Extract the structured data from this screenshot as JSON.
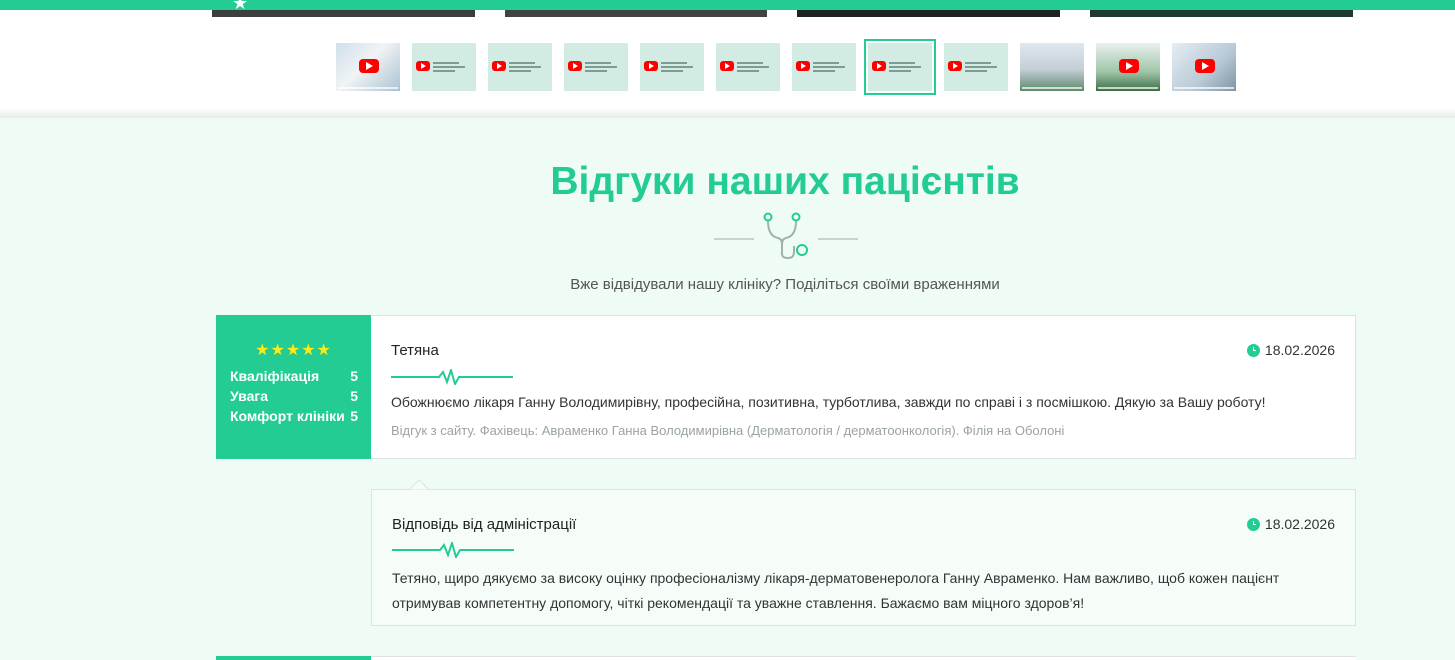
{
  "colors": {
    "accent": "#22cc93",
    "star": "#ffeb12",
    "background": "#effcf6"
  },
  "gallery": {
    "thumbnails": [
      {
        "style": "photo",
        "icon": "youtube-play-icon"
      },
      {
        "style": "text",
        "icon": "youtube-play-icon"
      },
      {
        "style": "text",
        "icon": "youtube-play-icon"
      },
      {
        "style": "text",
        "icon": "youtube-play-icon"
      },
      {
        "style": "text",
        "icon": "youtube-play-icon"
      },
      {
        "style": "text",
        "icon": "youtube-play-icon"
      },
      {
        "style": "text",
        "icon": "youtube-play-icon"
      },
      {
        "style": "text",
        "icon": "youtube-play-icon",
        "active": true
      },
      {
        "style": "text",
        "icon": "youtube-play-icon"
      },
      {
        "style": "building",
        "icon": ""
      },
      {
        "style": "green",
        "icon": "youtube-play-icon"
      },
      {
        "style": "hallway",
        "icon": "youtube-play-icon"
      }
    ]
  },
  "section": {
    "title": "Відгуки наших пацієнтів",
    "subtitle": "Вже відвідували нашу клініку? Поділіться своїми враженнями",
    "divider_icon": "stethoscope-icon"
  },
  "review": {
    "rating_stars": 5,
    "stars_text": "★★★★★",
    "criteria": [
      {
        "label": "Кваліфікація",
        "value": "5"
      },
      {
        "label": "Увага",
        "value": "5"
      },
      {
        "label": "Комфорт клініки",
        "value": "5"
      }
    ],
    "author": "Тетяна",
    "date": "18.02.2026",
    "text": "Обожнюємо лікаря Ганну Володимирівну, професійна, позитивна, турботлива, завжди по справі і з посмішкою. Дякую за Вашу роботу!",
    "meta": "Відгук з сайту. Фахівець: Авраменко Ганна Володимирівна (Дерматологія / дерматоонкологія). Філія на Оболоні"
  },
  "reply": {
    "title": "Відповідь від адміністрації",
    "date": "18.02.2026",
    "text": "Тетяно, щиро дякуємо за високу оцінку професіоналізму лікаря-дерматовенеролога Ганну Авраменко. Нам важливо, щоб кожен пацієнт отримував компетентну допомогу, чіткі рекомендації та уважне ставлення. Бажаємо вам міцного здоров’я!"
  }
}
